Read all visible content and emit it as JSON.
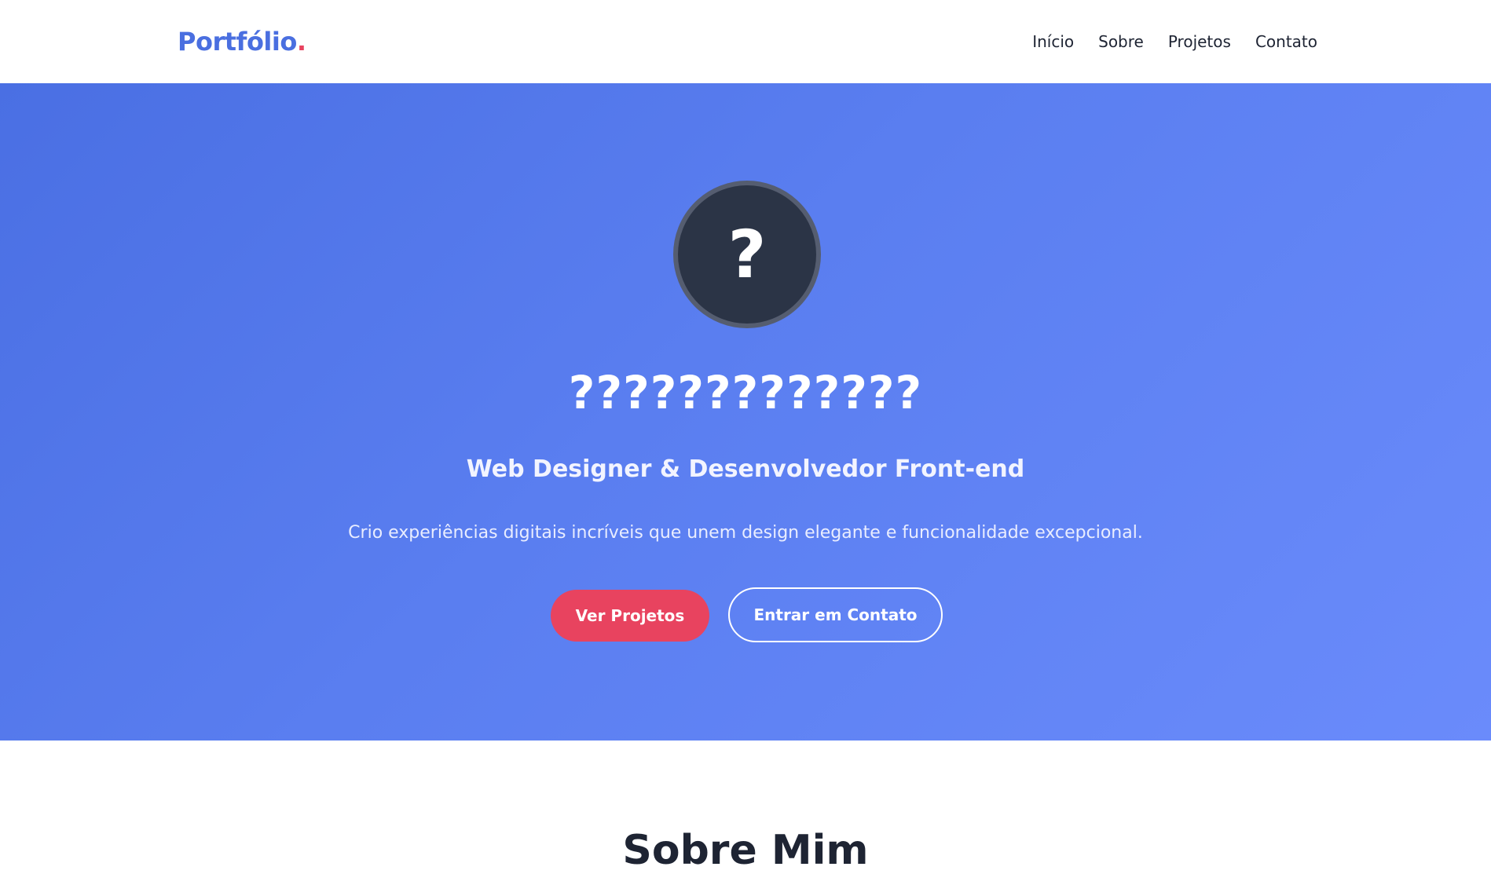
{
  "nav": {
    "logo_text": "Portfólio",
    "logo_dot": ".",
    "links": [
      "Início",
      "Sobre",
      "Projetos",
      "Contato"
    ]
  },
  "hero": {
    "avatar_glyph": "?",
    "title": "?????????????",
    "subtitle": "Web Designer & Desenvolvedor Front-end",
    "description": "Crio experiências digitais incríveis que unem design elegante e funcionalidade excepcional.",
    "primary_button": "Ver Projetos",
    "secondary_button": "Entrar em Contato"
  },
  "about": {
    "title": "Sobre Mim"
  },
  "colors": {
    "brand": "#4a6fe0",
    "accent": "#e8435f",
    "hero_gradient_start": "#4a6fe3",
    "hero_gradient_end": "#6a8bfb",
    "text_dark": "#1e2433"
  }
}
